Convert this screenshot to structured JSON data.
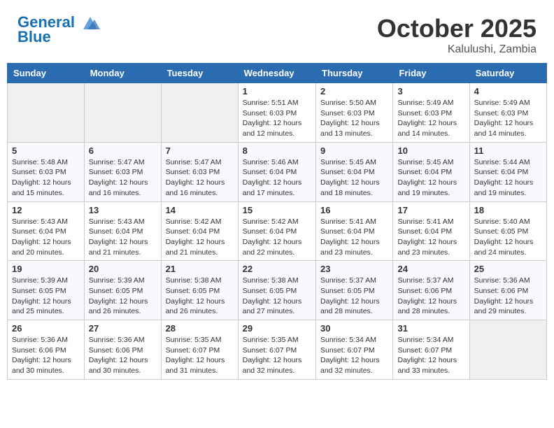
{
  "header": {
    "logo_line1": "General",
    "logo_line2": "Blue",
    "month": "October 2025",
    "location": "Kalulushi, Zambia"
  },
  "weekdays": [
    "Sunday",
    "Monday",
    "Tuesday",
    "Wednesday",
    "Thursday",
    "Friday",
    "Saturday"
  ],
  "weeks": [
    [
      {
        "day": "",
        "info": ""
      },
      {
        "day": "",
        "info": ""
      },
      {
        "day": "",
        "info": ""
      },
      {
        "day": "1",
        "info": "Sunrise: 5:51 AM\nSunset: 6:03 PM\nDaylight: 12 hours\nand 12 minutes."
      },
      {
        "day": "2",
        "info": "Sunrise: 5:50 AM\nSunset: 6:03 PM\nDaylight: 12 hours\nand 13 minutes."
      },
      {
        "day": "3",
        "info": "Sunrise: 5:49 AM\nSunset: 6:03 PM\nDaylight: 12 hours\nand 14 minutes."
      },
      {
        "day": "4",
        "info": "Sunrise: 5:49 AM\nSunset: 6:03 PM\nDaylight: 12 hours\nand 14 minutes."
      }
    ],
    [
      {
        "day": "5",
        "info": "Sunrise: 5:48 AM\nSunset: 6:03 PM\nDaylight: 12 hours\nand 15 minutes."
      },
      {
        "day": "6",
        "info": "Sunrise: 5:47 AM\nSunset: 6:03 PM\nDaylight: 12 hours\nand 16 minutes."
      },
      {
        "day": "7",
        "info": "Sunrise: 5:47 AM\nSunset: 6:03 PM\nDaylight: 12 hours\nand 16 minutes."
      },
      {
        "day": "8",
        "info": "Sunrise: 5:46 AM\nSunset: 6:04 PM\nDaylight: 12 hours\nand 17 minutes."
      },
      {
        "day": "9",
        "info": "Sunrise: 5:45 AM\nSunset: 6:04 PM\nDaylight: 12 hours\nand 18 minutes."
      },
      {
        "day": "10",
        "info": "Sunrise: 5:45 AM\nSunset: 6:04 PM\nDaylight: 12 hours\nand 19 minutes."
      },
      {
        "day": "11",
        "info": "Sunrise: 5:44 AM\nSunset: 6:04 PM\nDaylight: 12 hours\nand 19 minutes."
      }
    ],
    [
      {
        "day": "12",
        "info": "Sunrise: 5:43 AM\nSunset: 6:04 PM\nDaylight: 12 hours\nand 20 minutes."
      },
      {
        "day": "13",
        "info": "Sunrise: 5:43 AM\nSunset: 6:04 PM\nDaylight: 12 hours\nand 21 minutes."
      },
      {
        "day": "14",
        "info": "Sunrise: 5:42 AM\nSunset: 6:04 PM\nDaylight: 12 hours\nand 21 minutes."
      },
      {
        "day": "15",
        "info": "Sunrise: 5:42 AM\nSunset: 6:04 PM\nDaylight: 12 hours\nand 22 minutes."
      },
      {
        "day": "16",
        "info": "Sunrise: 5:41 AM\nSunset: 6:04 PM\nDaylight: 12 hours\nand 23 minutes."
      },
      {
        "day": "17",
        "info": "Sunrise: 5:41 AM\nSunset: 6:04 PM\nDaylight: 12 hours\nand 23 minutes."
      },
      {
        "day": "18",
        "info": "Sunrise: 5:40 AM\nSunset: 6:05 PM\nDaylight: 12 hours\nand 24 minutes."
      }
    ],
    [
      {
        "day": "19",
        "info": "Sunrise: 5:39 AM\nSunset: 6:05 PM\nDaylight: 12 hours\nand 25 minutes."
      },
      {
        "day": "20",
        "info": "Sunrise: 5:39 AM\nSunset: 6:05 PM\nDaylight: 12 hours\nand 26 minutes."
      },
      {
        "day": "21",
        "info": "Sunrise: 5:38 AM\nSunset: 6:05 PM\nDaylight: 12 hours\nand 26 minutes."
      },
      {
        "day": "22",
        "info": "Sunrise: 5:38 AM\nSunset: 6:05 PM\nDaylight: 12 hours\nand 27 minutes."
      },
      {
        "day": "23",
        "info": "Sunrise: 5:37 AM\nSunset: 6:05 PM\nDaylight: 12 hours\nand 28 minutes."
      },
      {
        "day": "24",
        "info": "Sunrise: 5:37 AM\nSunset: 6:06 PM\nDaylight: 12 hours\nand 28 minutes."
      },
      {
        "day": "25",
        "info": "Sunrise: 5:36 AM\nSunset: 6:06 PM\nDaylight: 12 hours\nand 29 minutes."
      }
    ],
    [
      {
        "day": "26",
        "info": "Sunrise: 5:36 AM\nSunset: 6:06 PM\nDaylight: 12 hours\nand 30 minutes."
      },
      {
        "day": "27",
        "info": "Sunrise: 5:36 AM\nSunset: 6:06 PM\nDaylight: 12 hours\nand 30 minutes."
      },
      {
        "day": "28",
        "info": "Sunrise: 5:35 AM\nSunset: 6:07 PM\nDaylight: 12 hours\nand 31 minutes."
      },
      {
        "day": "29",
        "info": "Sunrise: 5:35 AM\nSunset: 6:07 PM\nDaylight: 12 hours\nand 32 minutes."
      },
      {
        "day": "30",
        "info": "Sunrise: 5:34 AM\nSunset: 6:07 PM\nDaylight: 12 hours\nand 32 minutes."
      },
      {
        "day": "31",
        "info": "Sunrise: 5:34 AM\nSunset: 6:07 PM\nDaylight: 12 hours\nand 33 minutes."
      },
      {
        "day": "",
        "info": ""
      }
    ]
  ]
}
